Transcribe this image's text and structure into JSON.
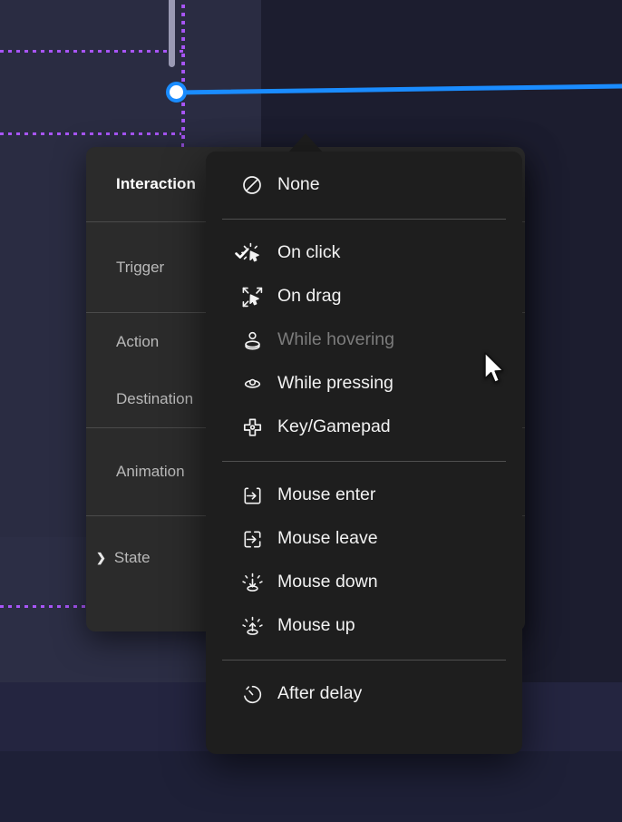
{
  "app": {
    "canvas_bg": "#1b1c2e",
    "guide_color": "#a855f7",
    "connection_color": "#1a8cff",
    "menu_bg": "#1e1e1e",
    "panel_bg": "#2b2b2b"
  },
  "panel": {
    "title": "Interaction",
    "rows": [
      {
        "label": "Trigger",
        "caret": ""
      },
      {
        "label": "Action",
        "caret": ""
      },
      {
        "label": "Destination",
        "caret": ""
      },
      {
        "label": "Animation",
        "caret": ""
      },
      {
        "label": "State",
        "caret": "❯"
      }
    ]
  },
  "menu": {
    "selected": "On click",
    "groups": [
      {
        "items": [
          {
            "label": "None",
            "icon": "no-entry-icon",
            "checked": false,
            "disabled": false
          }
        ]
      },
      {
        "items": [
          {
            "label": "On click",
            "icon": "cursor-click-icon",
            "checked": true,
            "disabled": false
          },
          {
            "label": "On drag",
            "icon": "cursor-drag-icon",
            "checked": false,
            "disabled": false
          },
          {
            "label": "While hovering",
            "icon": "hover-icon",
            "checked": false,
            "disabled": true
          },
          {
            "label": "While pressing",
            "icon": "press-icon",
            "checked": false,
            "disabled": false
          },
          {
            "label": "Key/Gamepad",
            "icon": "gamepad-dpad-icon",
            "checked": false,
            "disabled": false
          }
        ]
      },
      {
        "items": [
          {
            "label": "Mouse enter",
            "icon": "arrow-into-box-icon",
            "checked": false,
            "disabled": false
          },
          {
            "label": "Mouse leave",
            "icon": "arrow-out-of-box-icon",
            "checked": false,
            "disabled": false
          },
          {
            "label": "Mouse down",
            "icon": "mouse-down-icon",
            "checked": false,
            "disabled": false
          },
          {
            "label": "Mouse up",
            "icon": "mouse-up-icon",
            "checked": false,
            "disabled": false
          }
        ]
      },
      {
        "items": [
          {
            "label": "After delay",
            "icon": "stopwatch-icon",
            "checked": false,
            "disabled": false
          }
        ]
      }
    ]
  }
}
